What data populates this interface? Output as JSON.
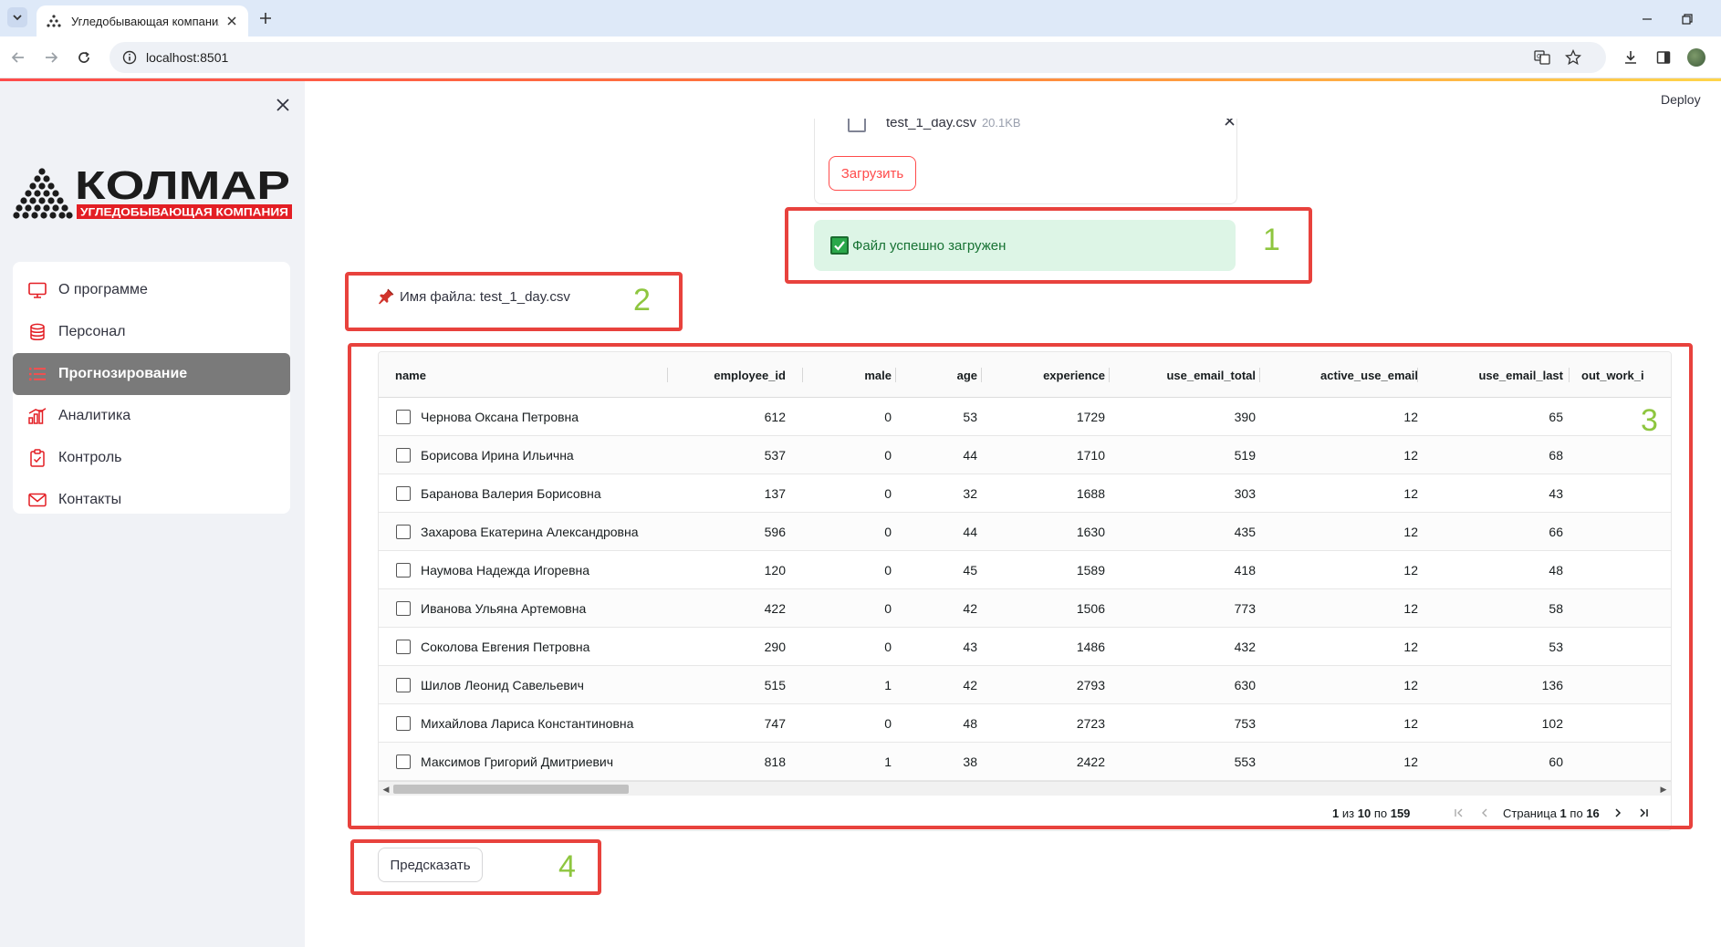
{
  "browser": {
    "tab_title": "Угледобывающая компания «",
    "url": "localhost:8501"
  },
  "app": {
    "deploy_label": "Deploy",
    "logo": {
      "brand": "КОЛМАР",
      "tagline": "УГЛЕДОБЫВАЮЩАЯ КОМПАНИЯ",
      "brand_color": "#e31e24"
    }
  },
  "sidebar": {
    "items": [
      {
        "label": "О программе",
        "icon": "monitor-icon",
        "active": false
      },
      {
        "label": "Персонал",
        "icon": "database-icon",
        "active": false
      },
      {
        "label": "Прогнозирование",
        "icon": "list-icon",
        "active": true
      },
      {
        "label": "Аналитика",
        "icon": "bar-chart-icon",
        "active": false
      },
      {
        "label": "Контроль",
        "icon": "clipboard-icon",
        "active": false
      },
      {
        "label": "Контакты",
        "icon": "envelope-icon",
        "active": false
      }
    ]
  },
  "uploader": {
    "file_name": "test_1_day.csv",
    "file_size": "20.1KB",
    "upload_label": "Загрузить"
  },
  "status": {
    "success_message": "Файл успешно загружен",
    "file_label": "Имя файла: test_1_day.csv"
  },
  "annotations": [
    "1",
    "2",
    "3",
    "4"
  ],
  "grid": {
    "columns": [
      "name",
      "employee_id",
      "male",
      "age",
      "experience",
      "use_email_total",
      "active_use_email",
      "use_email_last",
      "out_work_i"
    ],
    "rows": [
      [
        "Чернова Оксана Петровна",
        "612",
        "0",
        "53",
        "1729",
        "390",
        "12",
        "65"
      ],
      [
        "Борисова Ирина Ильична",
        "537",
        "0",
        "44",
        "1710",
        "519",
        "12",
        "68"
      ],
      [
        "Баранова Валерия Борисовна",
        "137",
        "0",
        "32",
        "1688",
        "303",
        "12",
        "43"
      ],
      [
        "Захарова Екатерина Александровна",
        "596",
        "0",
        "44",
        "1630",
        "435",
        "12",
        "66"
      ],
      [
        "Наумова Надежда Игоревна",
        "120",
        "0",
        "45",
        "1589",
        "418",
        "12",
        "48"
      ],
      [
        "Иванова Ульяна Артемовна",
        "422",
        "0",
        "42",
        "1506",
        "773",
        "12",
        "58"
      ],
      [
        "Соколова Евгения Петровна",
        "290",
        "0",
        "43",
        "1486",
        "432",
        "12",
        "53"
      ],
      [
        "Шилов Леонид Савельевич",
        "515",
        "1",
        "42",
        "2793",
        "630",
        "12",
        "136"
      ],
      [
        "Михайлова Лариса Константиновна",
        "747",
        "0",
        "48",
        "2723",
        "753",
        "12",
        "102"
      ],
      [
        "Максимов Григорий Дмитриевич",
        "818",
        "1",
        "38",
        "2422",
        "553",
        "12",
        "60"
      ]
    ],
    "pagination": {
      "from": "1",
      "to": "10",
      "total": "159",
      "of_word": "из",
      "by_word": "по",
      "page_word": "Страница",
      "page": "1",
      "pages": "16"
    }
  },
  "predict": {
    "label": "Предсказать"
  }
}
